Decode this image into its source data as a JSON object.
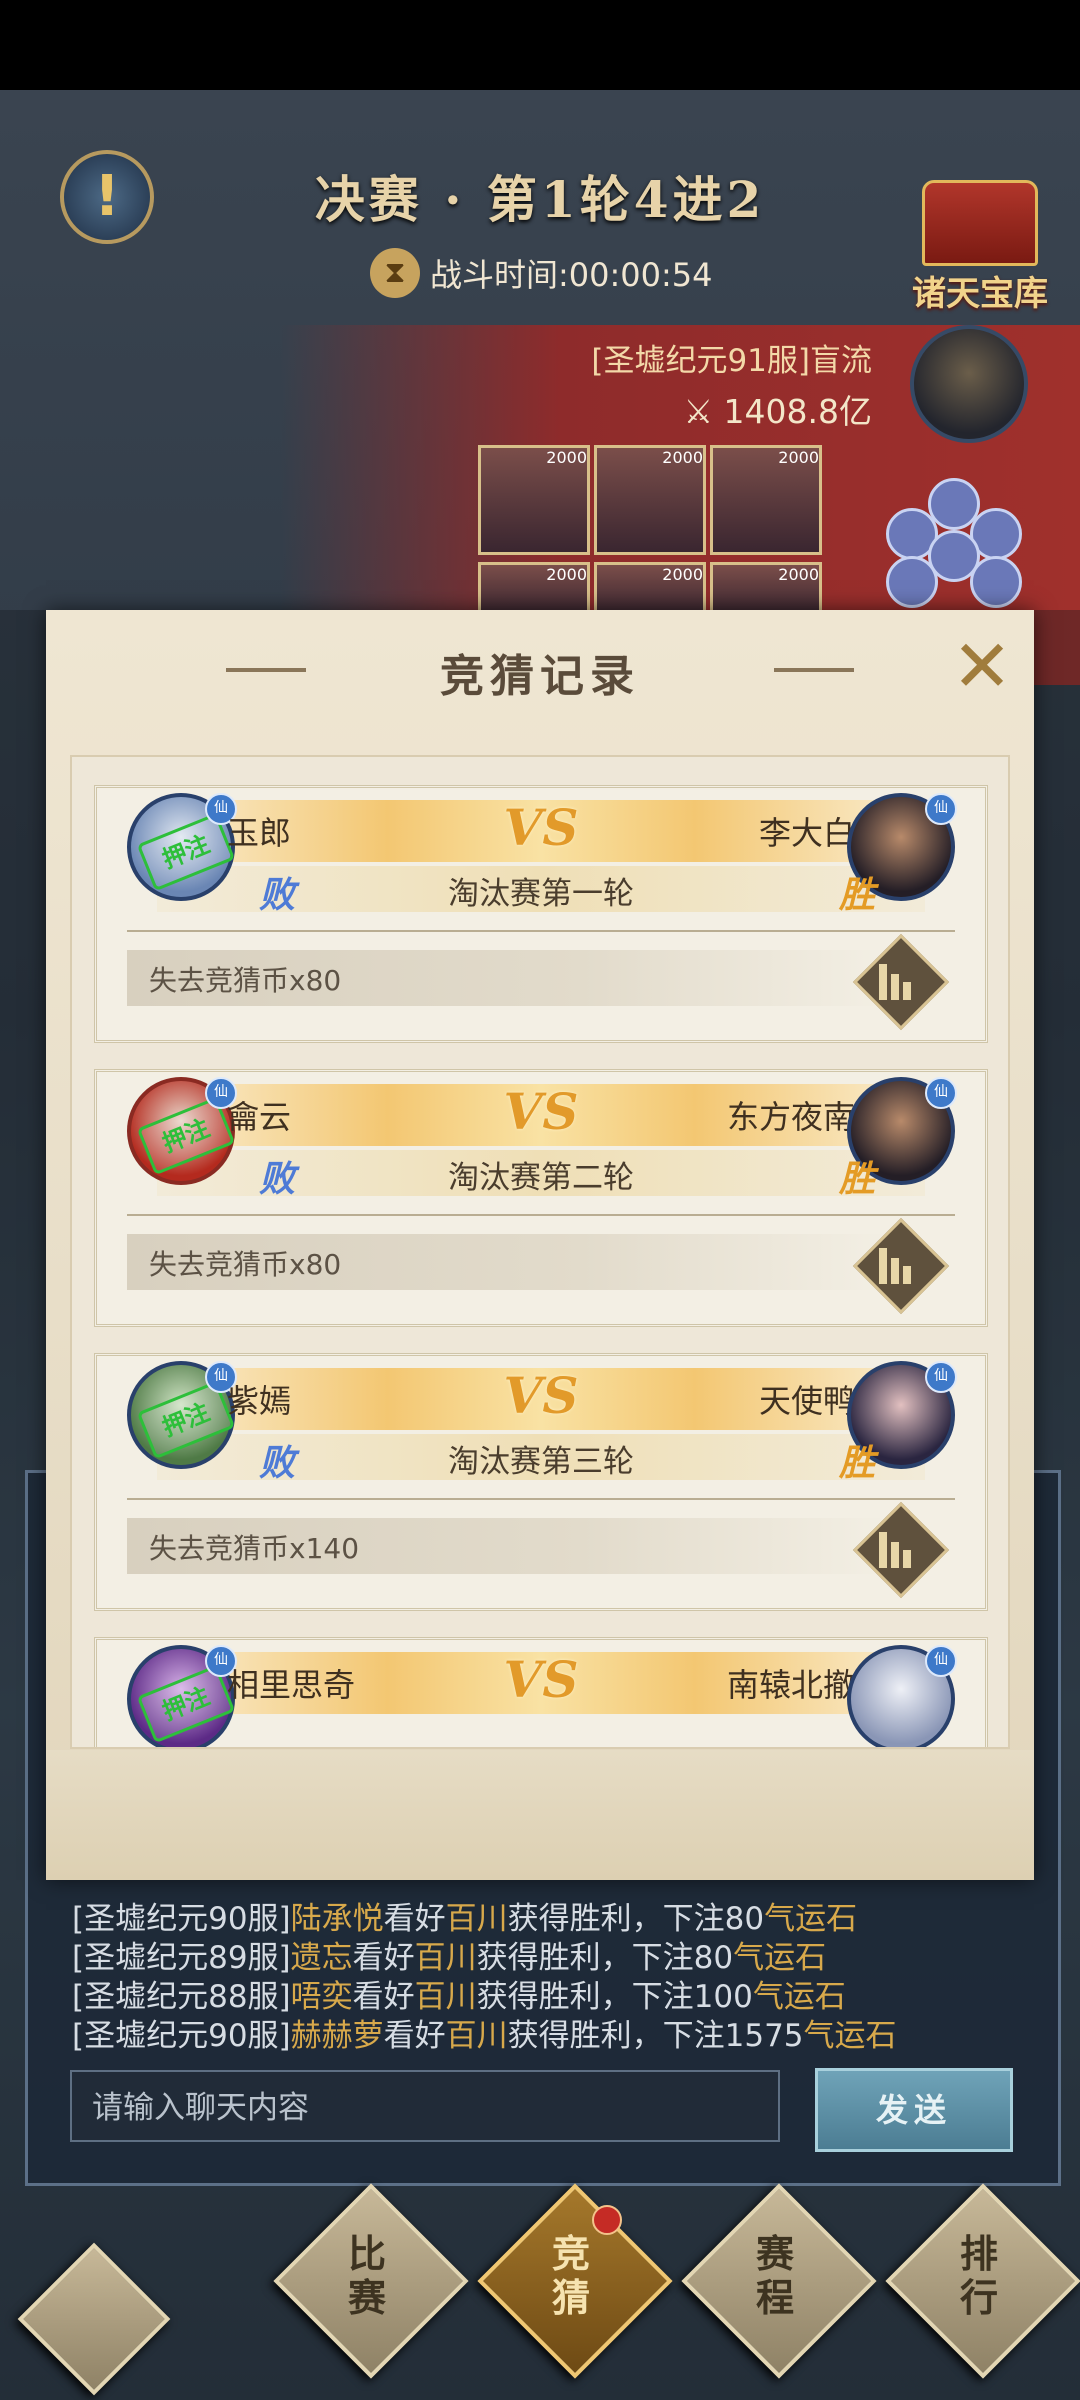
{
  "header": {
    "title": "决赛 · 第1轮4进2",
    "timer_label": "战斗时间:00:00:54",
    "treasury_label": "诸天宝库"
  },
  "opponent": {
    "name": "[圣墟纪元91服]盲流",
    "power": "1408.8亿",
    "card_level": "2000"
  },
  "modal": {
    "title": "竞猜记录",
    "records": [
      {
        "player_left": "玉郎",
        "player_right": "李大白",
        "left_result": "败",
        "right_result": "胜",
        "round": "淘汰赛第一轮",
        "outcome": "失去竞猜币x80",
        "stamp": "押注"
      },
      {
        "player_left": "龠云",
        "player_right": "东方夜南",
        "left_result": "败",
        "right_result": "胜",
        "round": "淘汰赛第二轮",
        "outcome": "失去竞猜币x80",
        "stamp": "押注"
      },
      {
        "player_left": "紫嫣",
        "player_right": "天使鸭",
        "left_result": "败",
        "right_result": "胜",
        "round": "淘汰赛第三轮",
        "outcome": "失去竞猜币x140",
        "stamp": "押注"
      },
      {
        "player_left": "相里思奇",
        "player_right": "南辕北撤",
        "stamp": "押注"
      }
    ],
    "vs_text": "VS",
    "badge_text": "仙"
  },
  "chat": {
    "lines": [
      {
        "server": "[圣墟纪元90服]",
        "user": "陆承悦",
        "mid1": "看好",
        "target": "百川",
        "mid2": "获得胜利，下注80",
        "currency": "气运石"
      },
      {
        "server": "[圣墟纪元89服]",
        "user": "遗忘",
        "mid1": "看好",
        "target": "百川",
        "mid2": "获得胜利，下注80",
        "currency": "气运石"
      },
      {
        "server": "[圣墟纪元88服]",
        "user": "唔奕",
        "mid1": "看好",
        "target": "百川",
        "mid2": "获得胜利，下注100",
        "currency": "气运石"
      },
      {
        "server": "[圣墟纪元90服]",
        "user": "赫赫萝",
        "mid1": "看好",
        "target": "百川",
        "mid2": "获得胜利，下注1575",
        "currency": "气运石"
      }
    ],
    "input_placeholder": "请输入聊天内容",
    "send_label": "发送"
  },
  "nav": {
    "items": [
      {
        "label_1": "比",
        "label_2": "赛",
        "active": false
      },
      {
        "label_1": "竞",
        "label_2": "猜",
        "active": true
      },
      {
        "label_1": "赛",
        "label_2": "程",
        "active": false
      },
      {
        "label_1": "排",
        "label_2": "行",
        "active": false
      }
    ]
  },
  "colors": {
    "accent_gold": "#e29a2a",
    "lose_blue": "#4e7bd6",
    "stamp_green": "#2dbf3a",
    "chat_highlight": "#d8a94b"
  }
}
